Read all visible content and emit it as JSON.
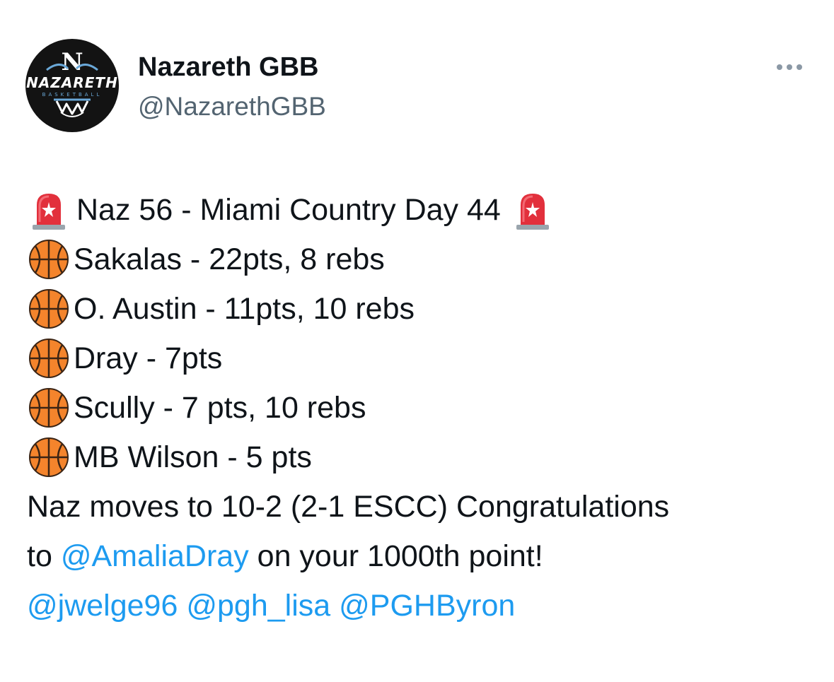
{
  "author": {
    "name": "Nazareth GBB",
    "handle": "@NazarethGBB",
    "avatar": {
      "icon": "nazareth-basketball-logo",
      "logo_letter": "N",
      "logo_text": "NAZARETH",
      "logo_subtext": "BASKETBALL",
      "background_color": "#131313",
      "accent_color": "#6aa8d8"
    }
  },
  "menu": {
    "icon": "more-horizontal-icon"
  },
  "tweet": {
    "headline": {
      "lead_icon": "rotating-light-emoji",
      "text": "Naz 56 - Miami Country Day 44",
      "trail_icon": "rotating-light-emoji"
    },
    "stat_lines": [
      {
        "icon": "basketball-emoji",
        "text": "Sakalas - 22pts, 8 rebs"
      },
      {
        "icon": "basketball-emoji",
        "text": "O. Austin - 11pts, 10 rebs"
      },
      {
        "icon": "basketball-emoji",
        "text": "Dray - 7pts"
      },
      {
        "icon": "basketball-emoji",
        "text": "Scully - 7 pts, 10 rebs"
      },
      {
        "icon": "basketball-emoji",
        "text": "MB Wilson - 5 pts"
      }
    ],
    "record_line": "Naz moves to 10-2 (2-1 ESCC) Congratulations",
    "congrats_prefix": "to",
    "congrats_mention": "@AmaliaDray",
    "congrats_suffix": "on your 1000th point!",
    "tagged_mentions": [
      "@jwelge96",
      "@pgh_lisa",
      "@PGHByron"
    ]
  },
  "colors": {
    "text": "#0f1419",
    "secondary_text": "#536471",
    "link": "#1d9bf0",
    "icon_muted": "#8b98a5"
  }
}
